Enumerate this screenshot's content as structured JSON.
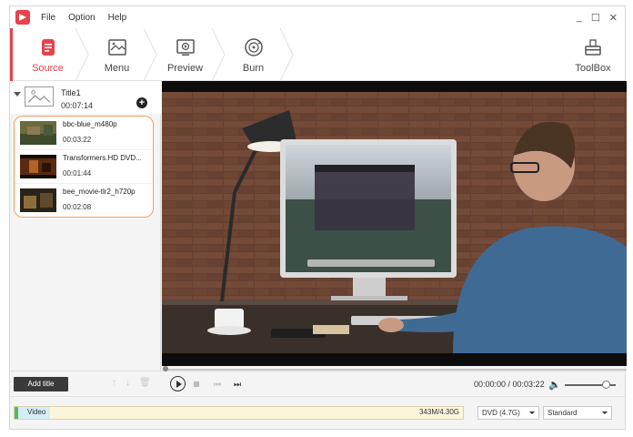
{
  "menu": {
    "items": [
      "File",
      "Option",
      "Help"
    ]
  },
  "window_controls": {
    "minimize": "_",
    "maximize": "☐",
    "close": "✕"
  },
  "toolbar": {
    "tabs": [
      {
        "label": "Source",
        "icon": "source-icon",
        "active": true
      },
      {
        "label": "Menu",
        "icon": "menu-template-icon",
        "active": false
      },
      {
        "label": "Preview",
        "icon": "preview-icon",
        "active": false
      },
      {
        "label": "Burn",
        "icon": "burn-disc-icon",
        "active": false
      }
    ],
    "toolbox": {
      "label": "ToolBox",
      "icon": "toolbox-icon"
    }
  },
  "title_entry": {
    "name": "Title1",
    "duration": "00:07:14"
  },
  "clips": [
    {
      "name": "bbc-blue_m480p",
      "duration": "00:03:22"
    },
    {
      "name": "Transformers.HD DVD...",
      "duration": "00:01:44"
    },
    {
      "name": "bee_movie-tlr2_h720p",
      "duration": "00:02:08"
    }
  ],
  "controls": {
    "add_title_label": "Add title",
    "time_readout": "00:00:00 / 00:03:22",
    "volume_level": 0.75,
    "playback_position": 0.0
  },
  "status": {
    "capacity_label": "Video",
    "capacity_size": "343M/4.30G",
    "capacity_fraction": 0.08,
    "disc_type": "DVD (4.7G)",
    "quality": "Standard"
  },
  "colors": {
    "accent": "#e8424a",
    "highlight_border": "#f0a060"
  }
}
